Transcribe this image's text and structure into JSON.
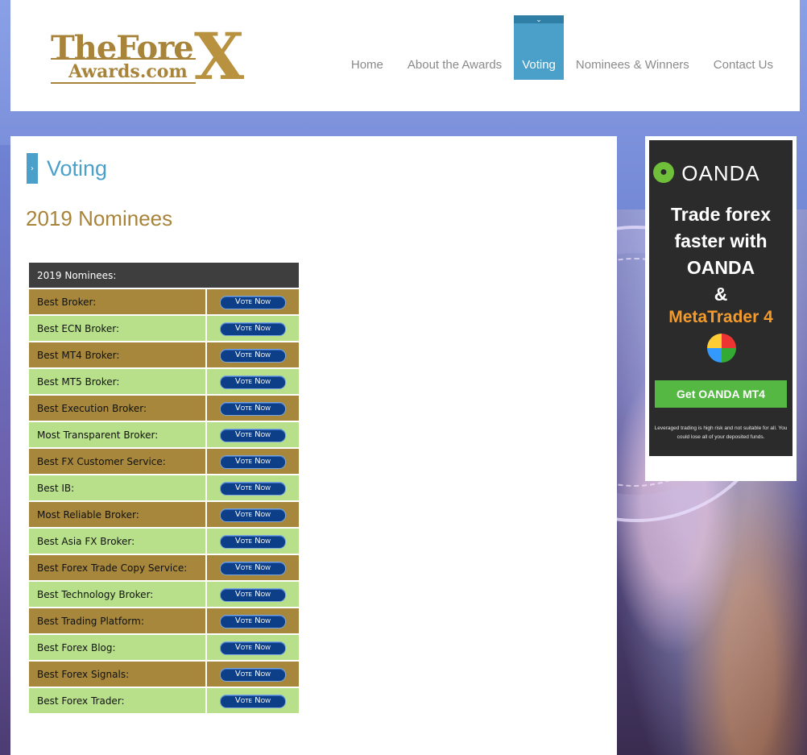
{
  "header": {
    "logo": {
      "line1": "TheFore",
      "line2": "Awards.com",
      "x": "X"
    },
    "nav": [
      {
        "label": "Home",
        "active": false
      },
      {
        "label": "About the Awards",
        "active": false
      },
      {
        "label": "Voting",
        "active": true
      },
      {
        "label": "Nominees & Winners",
        "active": false
      },
      {
        "label": "Contact Us",
        "active": false
      }
    ]
  },
  "main": {
    "page_title": "Voting",
    "section_title": "2019 Nominees",
    "table_header": "2019 Nominees:",
    "vote_label": "Vote Now",
    "categories": [
      "Best Broker:",
      "Best ECN Broker:",
      "Best MT4 Broker:",
      "Best MT5 Broker:",
      "Best Execution Broker:",
      "Most Transparent Broker:",
      "Best FX Customer Service:",
      "Best IB:",
      "Most Reliable Broker:",
      "Best Asia FX Broker:",
      "Best Forex Trade Copy Service:",
      "Best Technology Broker:",
      "Best Trading Platform:",
      "Best Forex Blog:",
      "Best Forex Signals:",
      "Best Forex Trader:"
    ]
  },
  "ad": {
    "brand": "OANDA",
    "headline_lines": [
      "Trade forex",
      "faster with",
      "OANDA",
      "&"
    ],
    "product": "MetaTrader 4",
    "cta": "Get OANDA MT4",
    "disclaimer": "Leveraged trading is high risk and not suitable for all. You could lose all of your deposited funds."
  },
  "colors": {
    "accent_blue": "#4aa0c9",
    "gold": "#a8843a",
    "row_odd": "#a6873b",
    "row_even": "#b8e08a",
    "button_blue": "#0c3f87"
  }
}
